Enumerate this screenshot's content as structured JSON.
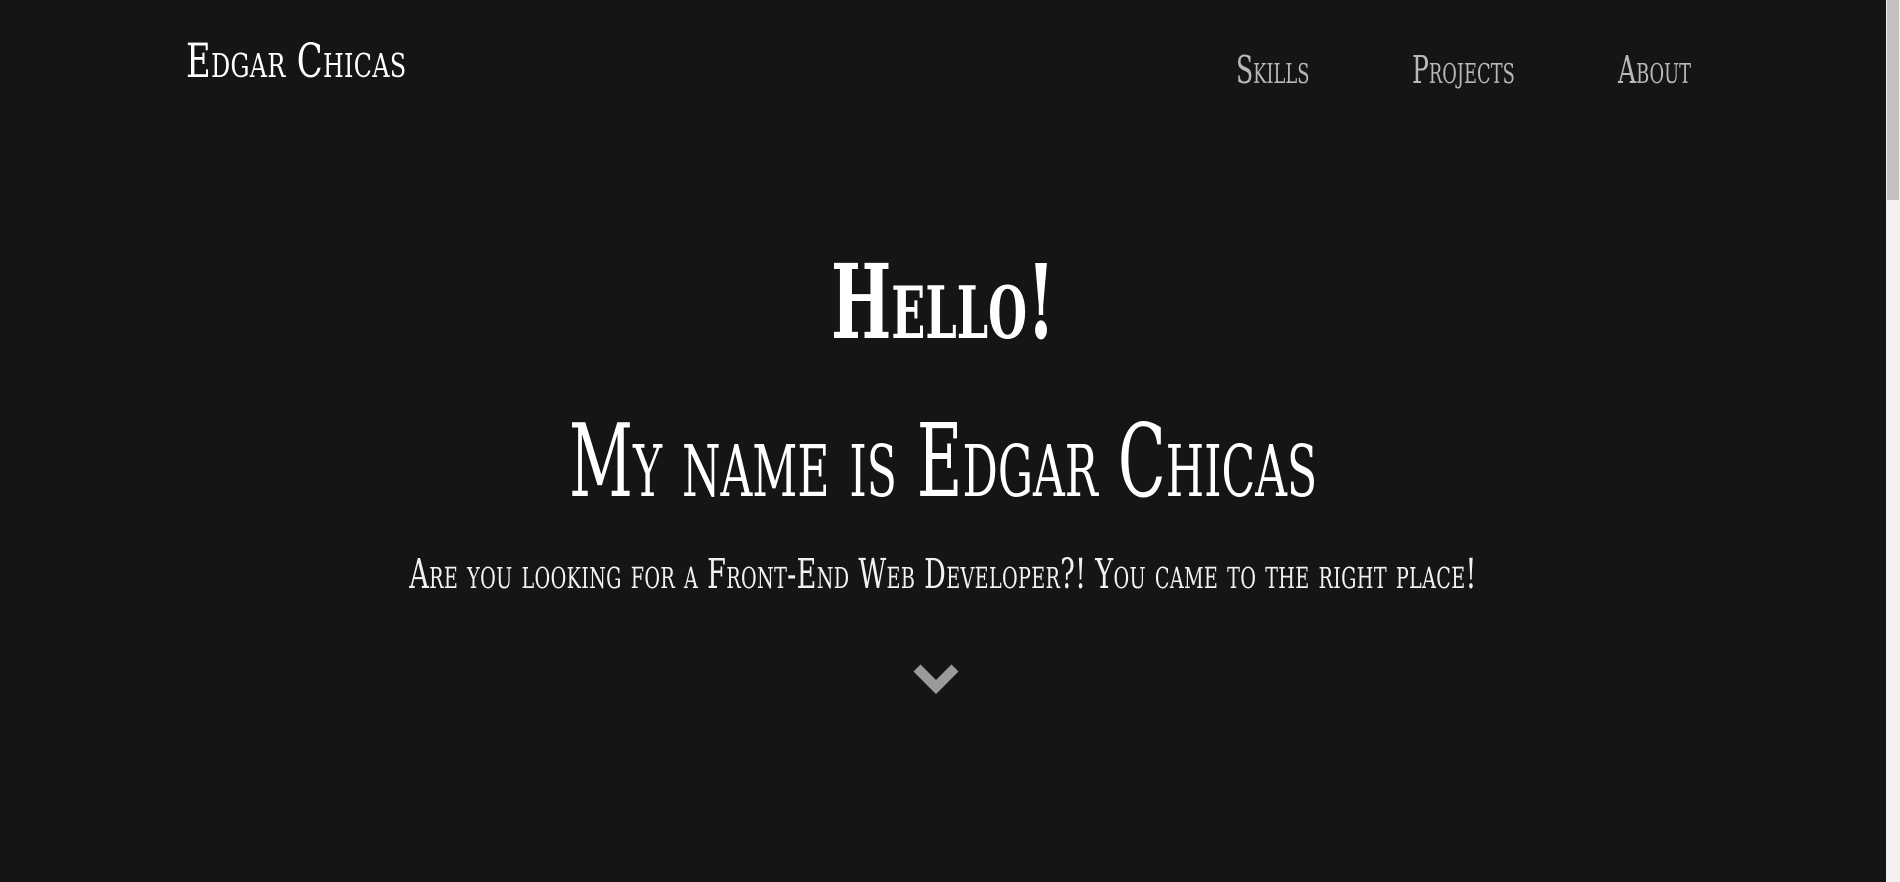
{
  "header": {
    "brand": "Edgar Chicas",
    "nav": [
      {
        "label": "Skills"
      },
      {
        "label": "Projects"
      },
      {
        "label": "About"
      }
    ]
  },
  "hero": {
    "greeting": "Hello!",
    "name_line": "My name is Edgar Chicas",
    "tagline": "Are you looking for a Front-End Web Developer?! You came to the right place!",
    "scroll_icon": "chevron-down-icon"
  },
  "colors": {
    "background": "#151515",
    "text": "#ffffff",
    "nav_text": "#b8b8b8",
    "chevron": "#9a9a9a"
  }
}
